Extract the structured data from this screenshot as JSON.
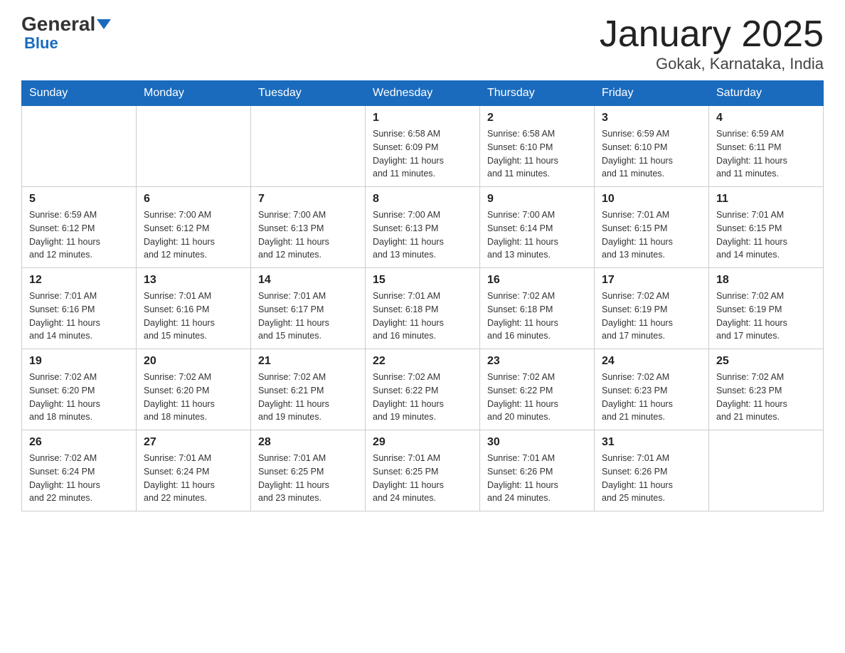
{
  "header": {
    "logo_general": "General",
    "logo_blue": "Blue",
    "title": "January 2025",
    "subtitle": "Gokak, Karnataka, India"
  },
  "days_of_week": [
    "Sunday",
    "Monday",
    "Tuesday",
    "Wednesday",
    "Thursday",
    "Friday",
    "Saturday"
  ],
  "weeks": [
    [
      {
        "day": "",
        "info": ""
      },
      {
        "day": "",
        "info": ""
      },
      {
        "day": "",
        "info": ""
      },
      {
        "day": "1",
        "info": "Sunrise: 6:58 AM\nSunset: 6:09 PM\nDaylight: 11 hours\nand 11 minutes."
      },
      {
        "day": "2",
        "info": "Sunrise: 6:58 AM\nSunset: 6:10 PM\nDaylight: 11 hours\nand 11 minutes."
      },
      {
        "day": "3",
        "info": "Sunrise: 6:59 AM\nSunset: 6:10 PM\nDaylight: 11 hours\nand 11 minutes."
      },
      {
        "day": "4",
        "info": "Sunrise: 6:59 AM\nSunset: 6:11 PM\nDaylight: 11 hours\nand 11 minutes."
      }
    ],
    [
      {
        "day": "5",
        "info": "Sunrise: 6:59 AM\nSunset: 6:12 PM\nDaylight: 11 hours\nand 12 minutes."
      },
      {
        "day": "6",
        "info": "Sunrise: 7:00 AM\nSunset: 6:12 PM\nDaylight: 11 hours\nand 12 minutes."
      },
      {
        "day": "7",
        "info": "Sunrise: 7:00 AM\nSunset: 6:13 PM\nDaylight: 11 hours\nand 12 minutes."
      },
      {
        "day": "8",
        "info": "Sunrise: 7:00 AM\nSunset: 6:13 PM\nDaylight: 11 hours\nand 13 minutes."
      },
      {
        "day": "9",
        "info": "Sunrise: 7:00 AM\nSunset: 6:14 PM\nDaylight: 11 hours\nand 13 minutes."
      },
      {
        "day": "10",
        "info": "Sunrise: 7:01 AM\nSunset: 6:15 PM\nDaylight: 11 hours\nand 13 minutes."
      },
      {
        "day": "11",
        "info": "Sunrise: 7:01 AM\nSunset: 6:15 PM\nDaylight: 11 hours\nand 14 minutes."
      }
    ],
    [
      {
        "day": "12",
        "info": "Sunrise: 7:01 AM\nSunset: 6:16 PM\nDaylight: 11 hours\nand 14 minutes."
      },
      {
        "day": "13",
        "info": "Sunrise: 7:01 AM\nSunset: 6:16 PM\nDaylight: 11 hours\nand 15 minutes."
      },
      {
        "day": "14",
        "info": "Sunrise: 7:01 AM\nSunset: 6:17 PM\nDaylight: 11 hours\nand 15 minutes."
      },
      {
        "day": "15",
        "info": "Sunrise: 7:01 AM\nSunset: 6:18 PM\nDaylight: 11 hours\nand 16 minutes."
      },
      {
        "day": "16",
        "info": "Sunrise: 7:02 AM\nSunset: 6:18 PM\nDaylight: 11 hours\nand 16 minutes."
      },
      {
        "day": "17",
        "info": "Sunrise: 7:02 AM\nSunset: 6:19 PM\nDaylight: 11 hours\nand 17 minutes."
      },
      {
        "day": "18",
        "info": "Sunrise: 7:02 AM\nSunset: 6:19 PM\nDaylight: 11 hours\nand 17 minutes."
      }
    ],
    [
      {
        "day": "19",
        "info": "Sunrise: 7:02 AM\nSunset: 6:20 PM\nDaylight: 11 hours\nand 18 minutes."
      },
      {
        "day": "20",
        "info": "Sunrise: 7:02 AM\nSunset: 6:20 PM\nDaylight: 11 hours\nand 18 minutes."
      },
      {
        "day": "21",
        "info": "Sunrise: 7:02 AM\nSunset: 6:21 PM\nDaylight: 11 hours\nand 19 minutes."
      },
      {
        "day": "22",
        "info": "Sunrise: 7:02 AM\nSunset: 6:22 PM\nDaylight: 11 hours\nand 19 minutes."
      },
      {
        "day": "23",
        "info": "Sunrise: 7:02 AM\nSunset: 6:22 PM\nDaylight: 11 hours\nand 20 minutes."
      },
      {
        "day": "24",
        "info": "Sunrise: 7:02 AM\nSunset: 6:23 PM\nDaylight: 11 hours\nand 21 minutes."
      },
      {
        "day": "25",
        "info": "Sunrise: 7:02 AM\nSunset: 6:23 PM\nDaylight: 11 hours\nand 21 minutes."
      }
    ],
    [
      {
        "day": "26",
        "info": "Sunrise: 7:02 AM\nSunset: 6:24 PM\nDaylight: 11 hours\nand 22 minutes."
      },
      {
        "day": "27",
        "info": "Sunrise: 7:01 AM\nSunset: 6:24 PM\nDaylight: 11 hours\nand 22 minutes."
      },
      {
        "day": "28",
        "info": "Sunrise: 7:01 AM\nSunset: 6:25 PM\nDaylight: 11 hours\nand 23 minutes."
      },
      {
        "day": "29",
        "info": "Sunrise: 7:01 AM\nSunset: 6:25 PM\nDaylight: 11 hours\nand 24 minutes."
      },
      {
        "day": "30",
        "info": "Sunrise: 7:01 AM\nSunset: 6:26 PM\nDaylight: 11 hours\nand 24 minutes."
      },
      {
        "day": "31",
        "info": "Sunrise: 7:01 AM\nSunset: 6:26 PM\nDaylight: 11 hours\nand 25 minutes."
      },
      {
        "day": "",
        "info": ""
      }
    ]
  ]
}
